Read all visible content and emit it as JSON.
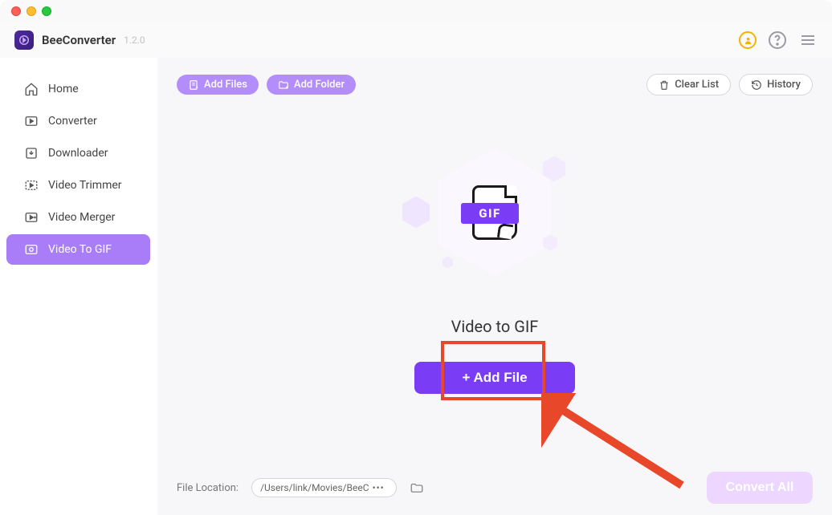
{
  "app": {
    "name": "BeeConverter",
    "version": "1.2.0"
  },
  "sidebar": {
    "items": [
      {
        "label": "Home",
        "icon": "home"
      },
      {
        "label": "Converter",
        "icon": "converter"
      },
      {
        "label": "Downloader",
        "icon": "downloader"
      },
      {
        "label": "Video Trimmer",
        "icon": "trimmer"
      },
      {
        "label": "Video Merger",
        "icon": "merger"
      },
      {
        "label": "Video To GIF",
        "icon": "gif",
        "active": true
      }
    ]
  },
  "toolbar": {
    "add_files": "Add Files",
    "add_folder": "Add Folder",
    "clear_list": "Clear List",
    "history": "History"
  },
  "empty": {
    "gif_badge": "GIF",
    "title": "Video to GIF",
    "add_file_btn": "+ Add File"
  },
  "footer": {
    "location_label": "File Location:",
    "location_path": "/Users/link/Movies/BeeC",
    "convert_all": "Convert All"
  }
}
